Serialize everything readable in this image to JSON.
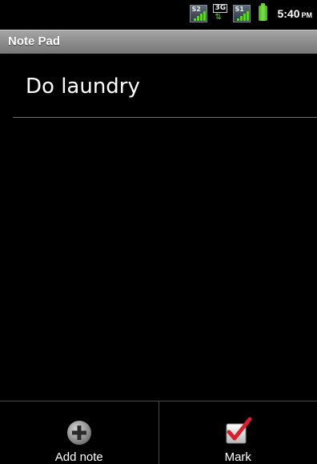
{
  "status_bar": {
    "signal_1_tag": "S2",
    "network_tag": "3G",
    "signal_2_tag": "S1",
    "clock": "5:40",
    "clock_ampm": "PM",
    "icons": [
      "signal-icon",
      "network-3g-icon",
      "signal-icon",
      "battery-icon"
    ]
  },
  "title_bar": {
    "title": "Note Pad"
  },
  "notes": [
    {
      "title": "Do laundry"
    }
  ],
  "menu": {
    "items": [
      {
        "label": "Add note",
        "icon": "add-icon"
      },
      {
        "label": "Mark",
        "icon": "checkmark-icon"
      }
    ]
  },
  "colors": {
    "background": "#000000",
    "title_bar": "#8c8c8c",
    "accent_green": "#5fd12e",
    "check_red": "#d8202a"
  }
}
